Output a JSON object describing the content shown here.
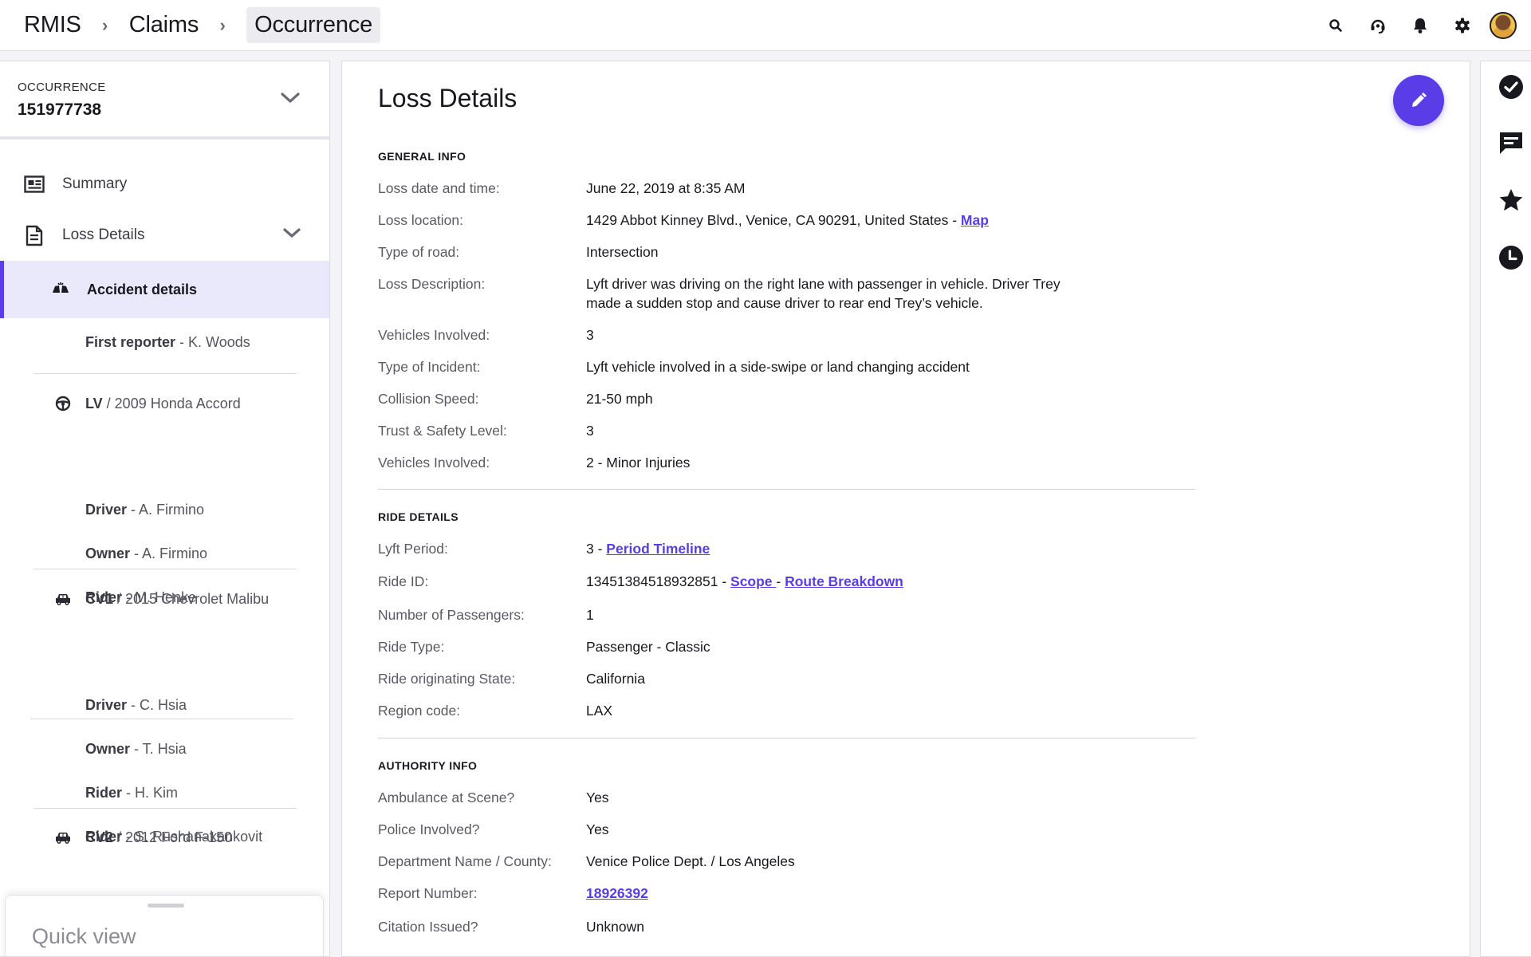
{
  "breadcrumb": [
    "RMIS",
    "Claims",
    "Occurrence"
  ],
  "top_icons": [
    "search-icon",
    "headset-icon",
    "bell-icon",
    "gear-icon",
    "avatar"
  ],
  "sidebar": {
    "occurrence_label": "OCCURRENCE",
    "occurrence_number": "151977738",
    "summary": "Summary",
    "loss_details": "Loss Details",
    "accident_details": "Accident details",
    "first_reporter": {
      "role": "First reporter",
      "name": " - K. Woods"
    },
    "vehicles": [
      {
        "code": "LV",
        "name": " / 2009 Honda Accord",
        "icon": "steering-wheel-icon",
        "people": [
          {
            "role": "Driver",
            "name": " - A. Firmino"
          },
          {
            "role": "Owner",
            "name": " - A. Firmino"
          },
          {
            "role": "Rider",
            "name": " - M. Henke"
          }
        ]
      },
      {
        "code": "CV1",
        "name": " / 2015 Chevrolet Malibu",
        "icon": "car-icon",
        "people": [
          {
            "role": "Driver",
            "name": " - C. Hsia"
          },
          {
            "role": "Owner",
            "name": " - T. Hsia"
          },
          {
            "role": "Rider",
            "name": " - H. Kim"
          },
          {
            "role": "Rider",
            "name": " - S. Rushanakankovit"
          }
        ]
      },
      {
        "code": "CV2",
        "name": " / 2012 Ford F-150",
        "icon": "car-icon",
        "people": []
      }
    ],
    "quick_view": "Quick view"
  },
  "main": {
    "title": "Loss Details",
    "general_info": {
      "heading": "GENERAL INFO",
      "loss_date_k": "Loss date and time:",
      "loss_date_v": "June 22, 2019 at 8:35 AM",
      "loss_location_k": "Loss location:",
      "loss_location_v": "1429 Abbot Kinney Blvd., Venice, CA 90291, United States - ",
      "map_link": "Map",
      "road_k": "Type of road:",
      "road_v": "Intersection",
      "desc_k": "Loss Description:",
      "desc_line1": "Lyft driver was driving on the right lane with passenger in vehicle. Driver Trey",
      "desc_line2": "made a sudden stop and cause driver to rear end Trey’s vehicle.",
      "vehicles_k": "Vehicles Involved:",
      "vehicles_v": "3",
      "incident_k": "Type of Incident:",
      "incident_v": "Lyft vehicle involved in a side-swipe or land changing accident",
      "speed_k": "Collision Speed:",
      "speed_v": "21-50 mph",
      "safety_k": "Trust & Safety Level:",
      "safety_v": "3",
      "vehicles2_k": "Vehicles Involved:",
      "vehicles2_v": "2 - Minor Injuries"
    },
    "ride_details": {
      "heading": "RIDE DETAILS",
      "period_k": "Lyft Period:",
      "period_v": "3 - ",
      "period_link": "Period Timeline",
      "ride_id_k": "Ride ID:",
      "ride_id_v": "13451384518932851 - ",
      "scope_link": "Scope ",
      "dash": " - ",
      "route_link": "Route Breakdown",
      "passengers_k": "Number of Passengers:",
      "passengers_v": "1",
      "ride_type_k": "Ride Type:",
      "ride_type_v": "Passenger - Classic",
      "state_k": "Ride originating State:",
      "state_v": "California",
      "region_k": "Region code:",
      "region_v": "LAX"
    },
    "authority_info": {
      "heading": "AUTHORITY INFO",
      "ambulance_k": "Ambulance at Scene?",
      "ambulance_v": "Yes",
      "police_k": "Police Involved?",
      "police_v": "Yes",
      "dept_k": "Department Name / County:",
      "dept_v": "Venice Police Dept. / Los Angeles",
      "report_k": "Report Number:",
      "report_link": "18926392",
      "citation_k": "Citation Issued?",
      "citation_v": "Unknown"
    }
  },
  "right_rail": [
    "check-circle-icon",
    "chat-icon",
    "star-icon",
    "clock-icon"
  ],
  "colors": {
    "accent": "#5A3DE6",
    "active_bg": "#E9E9FB",
    "text": "#18181F"
  }
}
